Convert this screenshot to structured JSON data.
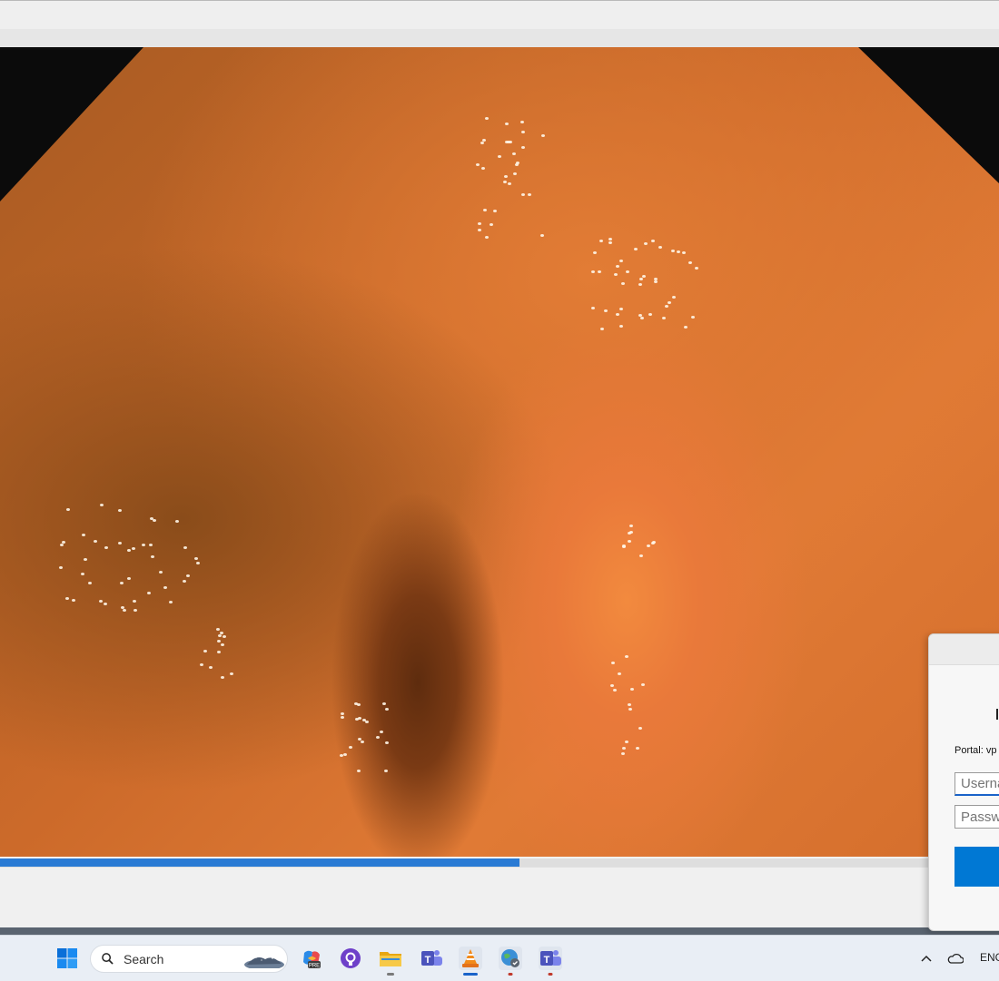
{
  "video": {
    "progress_fraction": 0.52
  },
  "vpn_dialog": {
    "portal_label": "Portal: vp",
    "username_placeholder": "Userna",
    "password_placeholder": "Passwo"
  },
  "taskbar": {
    "search_placeholder": "Search",
    "apps": [
      "copilot-icon",
      "github-desktop-icon",
      "file-explorer-icon",
      "teams-icon",
      "vlc-icon",
      "vpn-globe-icon",
      "teams-2-icon"
    ],
    "tray_language": "ENG"
  },
  "colors": {
    "accent": "#0078d4",
    "progress": "#2a7bd4"
  }
}
